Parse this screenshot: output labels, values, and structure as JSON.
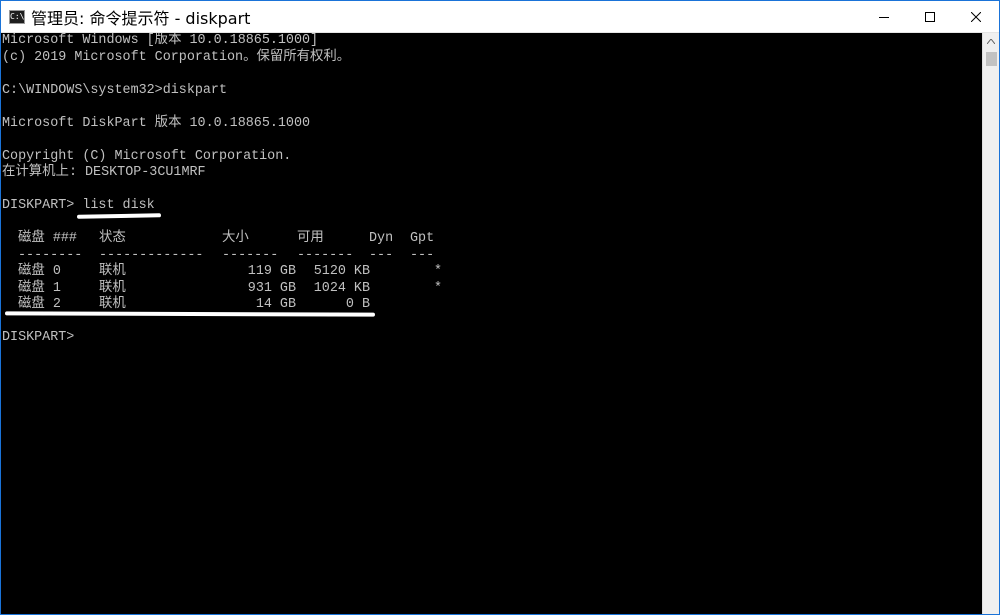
{
  "window": {
    "title": "管理员: 命令提示符 - diskpart",
    "icon": "cmd-icon",
    "icon_text": "C:\\"
  },
  "console": {
    "lines": [
      "Microsoft Windows [版本 10.0.18865.1000]",
      "(c) 2019 Microsoft Corporation。保留所有权利。",
      "",
      "C:\\WINDOWS\\system32>diskpart",
      "",
      "Microsoft DiskPart 版本 10.0.18865.1000",
      "",
      "Copyright (C) Microsoft Corporation.",
      "在计算机上: DESKTOP-3CU1MRF",
      "",
      "DISKPART> list disk"
    ],
    "table": {
      "headers": [
        "磁盘 ###",
        "状态",
        "大小",
        "可用",
        "Dyn",
        "Gpt"
      ],
      "separators": [
        "--------",
        "-------------",
        "-------",
        "-------",
        "---",
        "---"
      ],
      "rows": [
        [
          "磁盘 0",
          "联机",
          "119 GB",
          "5120 KB",
          "",
          "*"
        ],
        [
          "磁盘 1",
          "联机",
          "931 GB",
          "1024 KB",
          "",
          "*"
        ],
        [
          "磁盘 2",
          "联机",
          "14 GB",
          "0 B",
          "",
          ""
        ]
      ]
    },
    "prompt": "DISKPART>"
  },
  "annotations": {
    "color": "#ffffff"
  }
}
